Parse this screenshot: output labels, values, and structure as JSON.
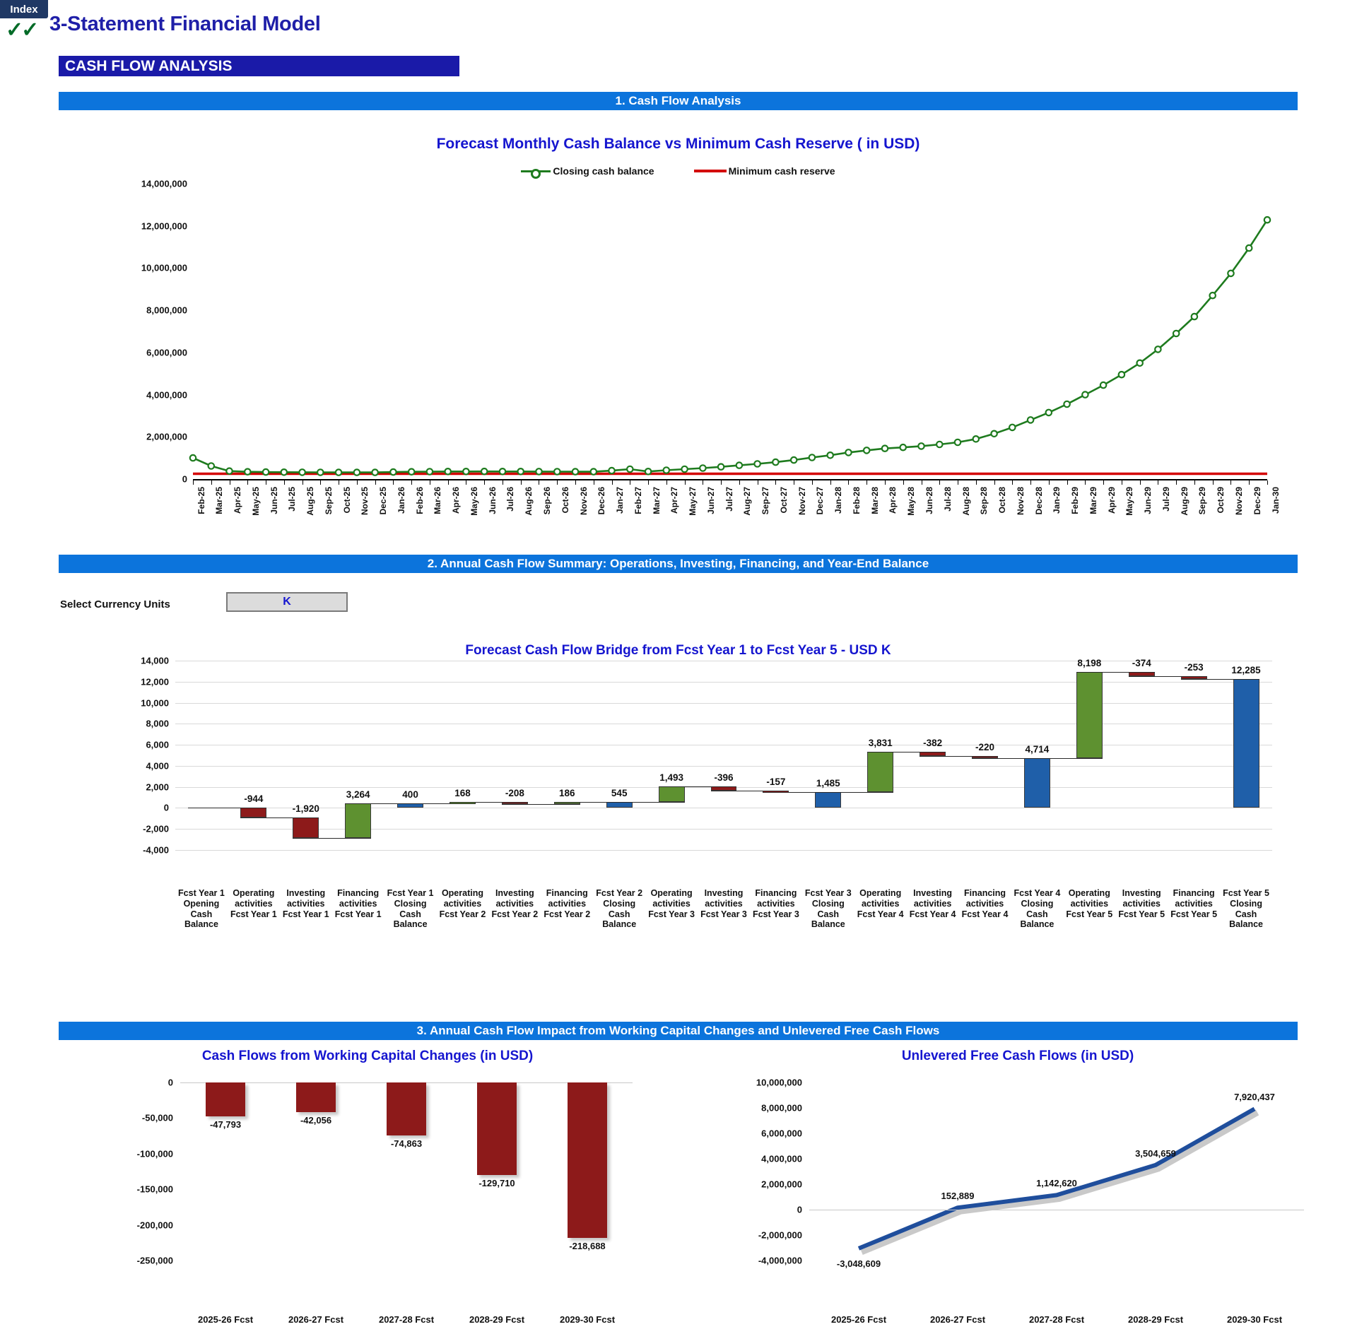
{
  "window": {
    "index_tab": "Index",
    "check_marks": "✓✓",
    "main_title": "3-Statement Financial Model",
    "section_title": "CASH FLOW ANALYSIS"
  },
  "bands": {
    "band1": "1. Cash Flow Analysis",
    "band2": "2. Annual Cash Flow Summary: Operations, Investing, Financing, and Year-End Balance",
    "band3": "3. Annual Cash Flow Impact from Working Capital Changes and Unlevered Free Cash Flows"
  },
  "currency_selector": {
    "label": "Select Currency Units",
    "value": "K"
  },
  "colors": {
    "accent_blue": "#0C74DC",
    "title_blue": "#1515CF",
    "dark_navy": "#1A1AA8",
    "green_series": "#1E7B1E",
    "red_series": "#D30000",
    "bar_green": "#5E9130",
    "bar_red": "#8D1A1A",
    "bar_blue": "#1F5FA9",
    "index_tab": "#1F3864",
    "check_green": "#006B27"
  },
  "chart_data": [
    {
      "id": "monthly_cash_balance",
      "type": "line",
      "title": "Forecast Monthly Cash Balance vs Minimum Cash Reserve ( in USD)",
      "xlabel": "",
      "ylabel": "",
      "ylim": [
        0,
        14000000
      ],
      "ytick_labels": [
        "14,000,000",
        "12,000,000",
        "10,000,000",
        "8,000,000",
        "6,000,000",
        "4,000,000",
        "2,000,000",
        "0"
      ],
      "yticks": [
        14000000,
        12000000,
        10000000,
        8000000,
        6000000,
        4000000,
        2000000,
        0
      ],
      "grid": false,
      "legend_position": "top",
      "legend": [
        "Closing cash balance",
        "Minimum cash reserve"
      ],
      "categories": [
        "Feb-25",
        "Mar-25",
        "Apr-25",
        "May-25",
        "Jun-25",
        "Jul-25",
        "Aug-25",
        "Sep-25",
        "Oct-25",
        "Nov-25",
        "Dec-25",
        "Jan-26",
        "Feb-26",
        "Mar-26",
        "Apr-26",
        "May-26",
        "Jun-26",
        "Jul-26",
        "Aug-26",
        "Sep-26",
        "Oct-26",
        "Nov-26",
        "Dec-26",
        "Jan-27",
        "Feb-27",
        "Mar-27",
        "Apr-27",
        "May-27",
        "Jun-27",
        "Jul-27",
        "Aug-27",
        "Sep-27",
        "Oct-27",
        "Nov-27",
        "Dec-27",
        "Jan-28",
        "Feb-28",
        "Mar-28",
        "Apr-28",
        "May-28",
        "Jun-28",
        "Jul-28",
        "Aug-28",
        "Sep-28",
        "Oct-28",
        "Nov-28",
        "Dec-28",
        "Jan-29",
        "Feb-29",
        "Mar-29",
        "Apr-29",
        "May-29",
        "Jun-29",
        "Jul-29",
        "Aug-29",
        "Sep-29",
        "Oct-29",
        "Nov-29",
        "Dec-29",
        "Jan-30"
      ],
      "series": [
        {
          "name": "Closing cash balance",
          "color": "#1E7B1E",
          "values": [
            1000000,
            620000,
            380000,
            345000,
            330000,
            325000,
            320000,
            318000,
            316000,
            315000,
            314000,
            330000,
            345000,
            352000,
            358000,
            360000,
            362000,
            360000,
            358000,
            356000,
            352000,
            350000,
            348000,
            400000,
            470000,
            360000,
            420000,
            470000,
            520000,
            580000,
            650000,
            720000,
            800000,
            900000,
            1020000,
            1130000,
            1260000,
            1360000,
            1450000,
            1500000,
            1560000,
            1640000,
            1740000,
            1900000,
            2150000,
            2450000,
            2800000,
            3150000,
            3550000,
            4000000,
            4450000,
            4950000,
            5500000,
            6150000,
            6900000,
            7700000,
            8700000,
            9750000,
            10950000,
            12285000
          ]
        },
        {
          "name": "Minimum cash reserve",
          "color": "#D30000",
          "values": [
            250000,
            250000,
            250000,
            250000,
            250000,
            250000,
            250000,
            250000,
            250000,
            250000,
            250000,
            250000,
            250000,
            250000,
            250000,
            250000,
            250000,
            250000,
            250000,
            250000,
            250000,
            250000,
            250000,
            250000,
            250000,
            250000,
            250000,
            250000,
            250000,
            250000,
            250000,
            250000,
            250000,
            250000,
            250000,
            250000,
            250000,
            250000,
            250000,
            250000,
            250000,
            250000,
            250000,
            250000,
            250000,
            250000,
            250000,
            250000,
            250000,
            250000,
            250000,
            250000,
            250000,
            250000,
            250000,
            250000,
            250000,
            250000,
            250000,
            250000
          ]
        }
      ]
    },
    {
      "id": "cash_flow_bridge",
      "type": "waterfall",
      "title": "Forecast Cash Flow Bridge from Fcst Year 1 to Fcst Year 5 - USD K",
      "xlabel": "",
      "ylabel": "",
      "ylim": [
        -4000,
        14000
      ],
      "yticks": [
        14000,
        12000,
        10000,
        8000,
        6000,
        4000,
        2000,
        0,
        -2000,
        -4000
      ],
      "ytick_labels": [
        "14,000",
        "12,000",
        "10,000",
        "8,000",
        "6,000",
        "4,000",
        "2,000",
        "0",
        "-2,000",
        "-4,000"
      ],
      "grid": false,
      "legend_position": "none",
      "categories": [
        "Fcst Year 1 Opening Cash Balance",
        "Operating activities Fcst Year 1",
        "Investing activities Fcst Year 1",
        "Financing activities Fcst Year 1",
        "Fcst Year 1 Closing Cash Balance",
        "Operating activities Fcst Year 2",
        "Investing activities Fcst Year 2",
        "Financing activities Fcst Year 2",
        "Fcst Year 2 Closing Cash Balance",
        "Operating activities Fcst Year 3",
        "Investing activities Fcst Year 3",
        "Financing activities Fcst Year 3",
        "Fcst Year 3 Closing Cash Balance",
        "Operating activities Fcst Year 4",
        "Investing activities Fcst Year 4",
        "Financing activities Fcst Year 4",
        "Fcst Year 4 Closing Cash Balance",
        "Operating activities Fcst Year 5",
        "Investing activities Fcst Year 5",
        "Financing activities Fcst Year 5",
        "Fcst Year 5 Closing Cash Balance"
      ],
      "labels": [
        "",
        "-944",
        "-1,920",
        "3,264",
        "400",
        "168",
        "-208",
        "186",
        "545",
        "1,493",
        "-396",
        "-157",
        "1,485",
        "3,831",
        "-382",
        "-220",
        "4,714",
        "8,198",
        "-374",
        "-253",
        "12,285"
      ],
      "values": [
        0,
        -944,
        -1920,
        3264,
        400,
        168,
        -208,
        186,
        545,
        1493,
        -396,
        -157,
        1485,
        3831,
        -382,
        -220,
        4714,
        8198,
        -374,
        -253,
        12285
      ],
      "kinds": [
        "start",
        "neg",
        "neg",
        "pos",
        "total",
        "pos",
        "neg",
        "pos",
        "total",
        "pos",
        "neg",
        "neg",
        "total",
        "pos",
        "neg",
        "neg",
        "total",
        "pos",
        "neg",
        "neg",
        "total"
      ]
    },
    {
      "id": "working_capital_changes",
      "type": "bar",
      "title": "Cash Flows from Working Capital Changes (in USD)",
      "xlabel": "",
      "ylabel": "",
      "ylim": [
        -250000,
        0
      ],
      "yticks": [
        0,
        -50000,
        -100000,
        -150000,
        -200000,
        -250000
      ],
      "ytick_labels": [
        "0",
        "-50,000",
        "-100,000",
        "-150,000",
        "-200,000",
        "-250,000"
      ],
      "grid": false,
      "legend_position": "none",
      "categories": [
        "2025-26 Fcst",
        "2026-27 Fcst",
        "2027-28 Fcst",
        "2028-29 Fcst",
        "2029-30 Fcst"
      ],
      "values": [
        -47793,
        -42056,
        -74863,
        -129710,
        -218688
      ],
      "labels": [
        "-47,793",
        "-42,056",
        "-74,863",
        "-129,710",
        "-218,688"
      ],
      "color": "#8D1A1A"
    },
    {
      "id": "unlevered_free_cash_flows",
      "type": "line",
      "title": "Unlevered Free Cash Flows (in USD)",
      "xlabel": "",
      "ylabel": "",
      "ylim": [
        -4000000,
        10000000
      ],
      "yticks": [
        10000000,
        8000000,
        6000000,
        4000000,
        2000000,
        0,
        -2000000,
        -4000000
      ],
      "ytick_labels": [
        "10,000,000",
        "8,000,000",
        "6,000,000",
        "4,000,000",
        "2,000,000",
        "0",
        "-2,000,000",
        "-4,000,000"
      ],
      "grid": false,
      "legend_position": "none",
      "categories": [
        "2025-26 Fcst",
        "2026-27 Fcst",
        "2027-28 Fcst",
        "2028-29 Fcst",
        "2029-30 Fcst"
      ],
      "values": [
        -3048609,
        152889,
        1142620,
        3504659,
        7920437
      ],
      "labels": [
        "-3,048,609",
        "152,889",
        "1,142,620",
        "3,504,659",
        "7,920,437"
      ],
      "color": "#1F4E9C"
    }
  ]
}
